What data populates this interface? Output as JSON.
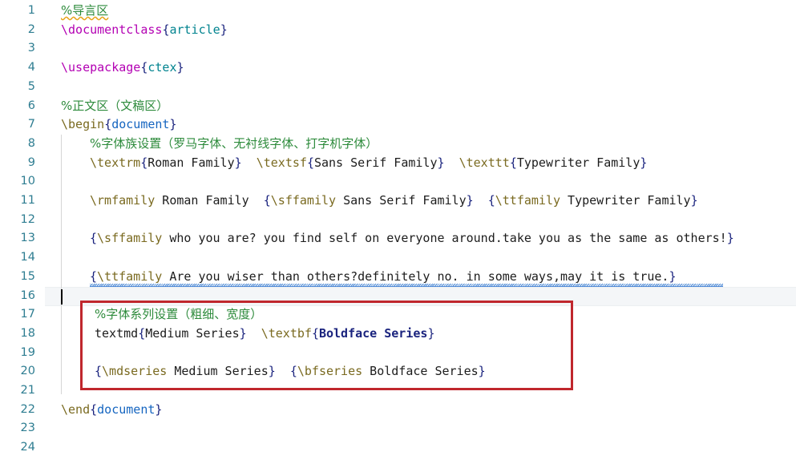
{
  "editor": {
    "name": "latex-source-editor",
    "total_lines_visible": 24,
    "current_line": 16,
    "colors": {
      "background": "#ffffff",
      "line_number": "#2e7d91",
      "comment_green": "#2e8b3c",
      "command_olive": "#7a6a20",
      "command_magenta": "#b300b3",
      "brace_navy": "#1a237e",
      "argument_teal": "#00838f",
      "argument_blue": "#1565c0",
      "plain_text": "#1c1c1c",
      "current_line_bg": "#f4f6f8",
      "annotation_red": "#c0272d",
      "spell_squiggle_blue": "#3d7fd1",
      "spell_squiggle_orange": "#e8a317"
    }
  },
  "line_numbers": [
    "1",
    "2",
    "3",
    "4",
    "5",
    "6",
    "7",
    "8",
    "9",
    "10",
    "11",
    "12",
    "13",
    "14",
    "15",
    "16",
    "17",
    "18",
    "19",
    "20",
    "21",
    "22",
    "23",
    "24"
  ],
  "lines": [
    {
      "n": "1",
      "text": "%导言区"
    },
    {
      "n": "2",
      "text": "\\documentclass{article}"
    },
    {
      "n": "3",
      "text": ""
    },
    {
      "n": "4",
      "text": "\\usepackage{ctex}"
    },
    {
      "n": "5",
      "text": ""
    },
    {
      "n": "6",
      "text": "%正文区（文稿区）"
    },
    {
      "n": "7",
      "text": "\\begin{document}"
    },
    {
      "n": "8",
      "text": "    %字体族设置（罗马字体、无衬线字体、打字机字体）"
    },
    {
      "n": "9",
      "text": "    \\textrm{Roman Family}  \\textsf{Sans Serif Family}  \\texttt{Typewriter Family}"
    },
    {
      "n": "10",
      "text": ""
    },
    {
      "n": "11",
      "text": "    \\rmfamily Roman Family  {\\sffamily Sans Serif Family}  {\\ttfamily Typewriter Family}"
    },
    {
      "n": "12",
      "text": ""
    },
    {
      "n": "13",
      "text": "    {\\sffamily who you are? you find self on everyone around.take you as the same as others!}"
    },
    {
      "n": "14",
      "text": ""
    },
    {
      "n": "15",
      "text": "    {\\ttfamily Are you wiser than others?definitely no. in some ways,may it is true.}"
    },
    {
      "n": "16",
      "text": ""
    },
    {
      "n": "17",
      "text": "    %字体系列设置（粗细、宽度）"
    },
    {
      "n": "18",
      "text": "    textmd{Medium Series}  \\textbf{Boldface Series}"
    },
    {
      "n": "19",
      "text": ""
    },
    {
      "n": "20",
      "text": "    {\\mdseries Medium Series}  {\\bfseries Boldface Series}"
    },
    {
      "n": "21",
      "text": ""
    },
    {
      "n": "22",
      "text": "\\end{document}"
    },
    {
      "n": "23",
      "text": ""
    },
    {
      "n": "24",
      "text": ""
    }
  ],
  "tokens": {
    "l1_comment": "%导言区",
    "l2_cmd": "\\documentclass",
    "l2_open": "{",
    "l2_arg": "article",
    "l2_close": "}",
    "l4_cmd": "\\usepackage",
    "l4_open": "{",
    "l4_arg": "ctex",
    "l4_close": "}",
    "l6_comment": "%正文区（文稿区）",
    "l7_cmd": "\\begin",
    "l7_open": "{",
    "l7_arg": "document",
    "l7_close": "}",
    "l8_comment": "%字体族设置（罗马字体、无衬线字体、打字机字体）",
    "l9_cmd1": "\\textrm",
    "l9_arg1": "Roman Family",
    "l9_cmd2": "\\textsf",
    "l9_arg2": "Sans Serif Family",
    "l9_cmd3": "\\texttt",
    "l9_arg3": "Typewriter Family",
    "l11_cmd1": "\\rmfamily",
    "l11_txt1": " Roman Family  ",
    "l11_cmd2": "\\sffamily",
    "l11_txt2": " Sans Serif Family",
    "l11_cmd3": "\\ttfamily",
    "l11_txt3": " Typewriter Family",
    "l13_cmd": "\\sffamily",
    "l13_txt": " who you are? you find self on everyone around.take you as the same as others!",
    "l15_cmd": "\\ttfamily",
    "l15_txt": " Are you wiser than others?definitely no. in some ways,may it is true.",
    "l17_comment": "%字体系列设置（粗细、宽度）",
    "l18_plain": "textmd",
    "l18_arg1": "Medium Series",
    "l18_cmd2": "\\textbf",
    "l18_arg2": "Boldface Series",
    "l20_cmd1": "\\mdseries",
    "l20_txt1": " Medium Series",
    "l20_cmd2": "\\bfseries",
    "l20_txt2": " Boldface Series",
    "l22_cmd": "\\end",
    "l22_open": "{",
    "l22_arg": "document",
    "l22_close": "}",
    "open_brace": "{",
    "close_brace": "}",
    "gap2": "  "
  },
  "annotation": {
    "name": "red-highlight-rectangle",
    "covers_lines": [
      "17",
      "18",
      "19",
      "20"
    ],
    "color": "#c0272d"
  }
}
